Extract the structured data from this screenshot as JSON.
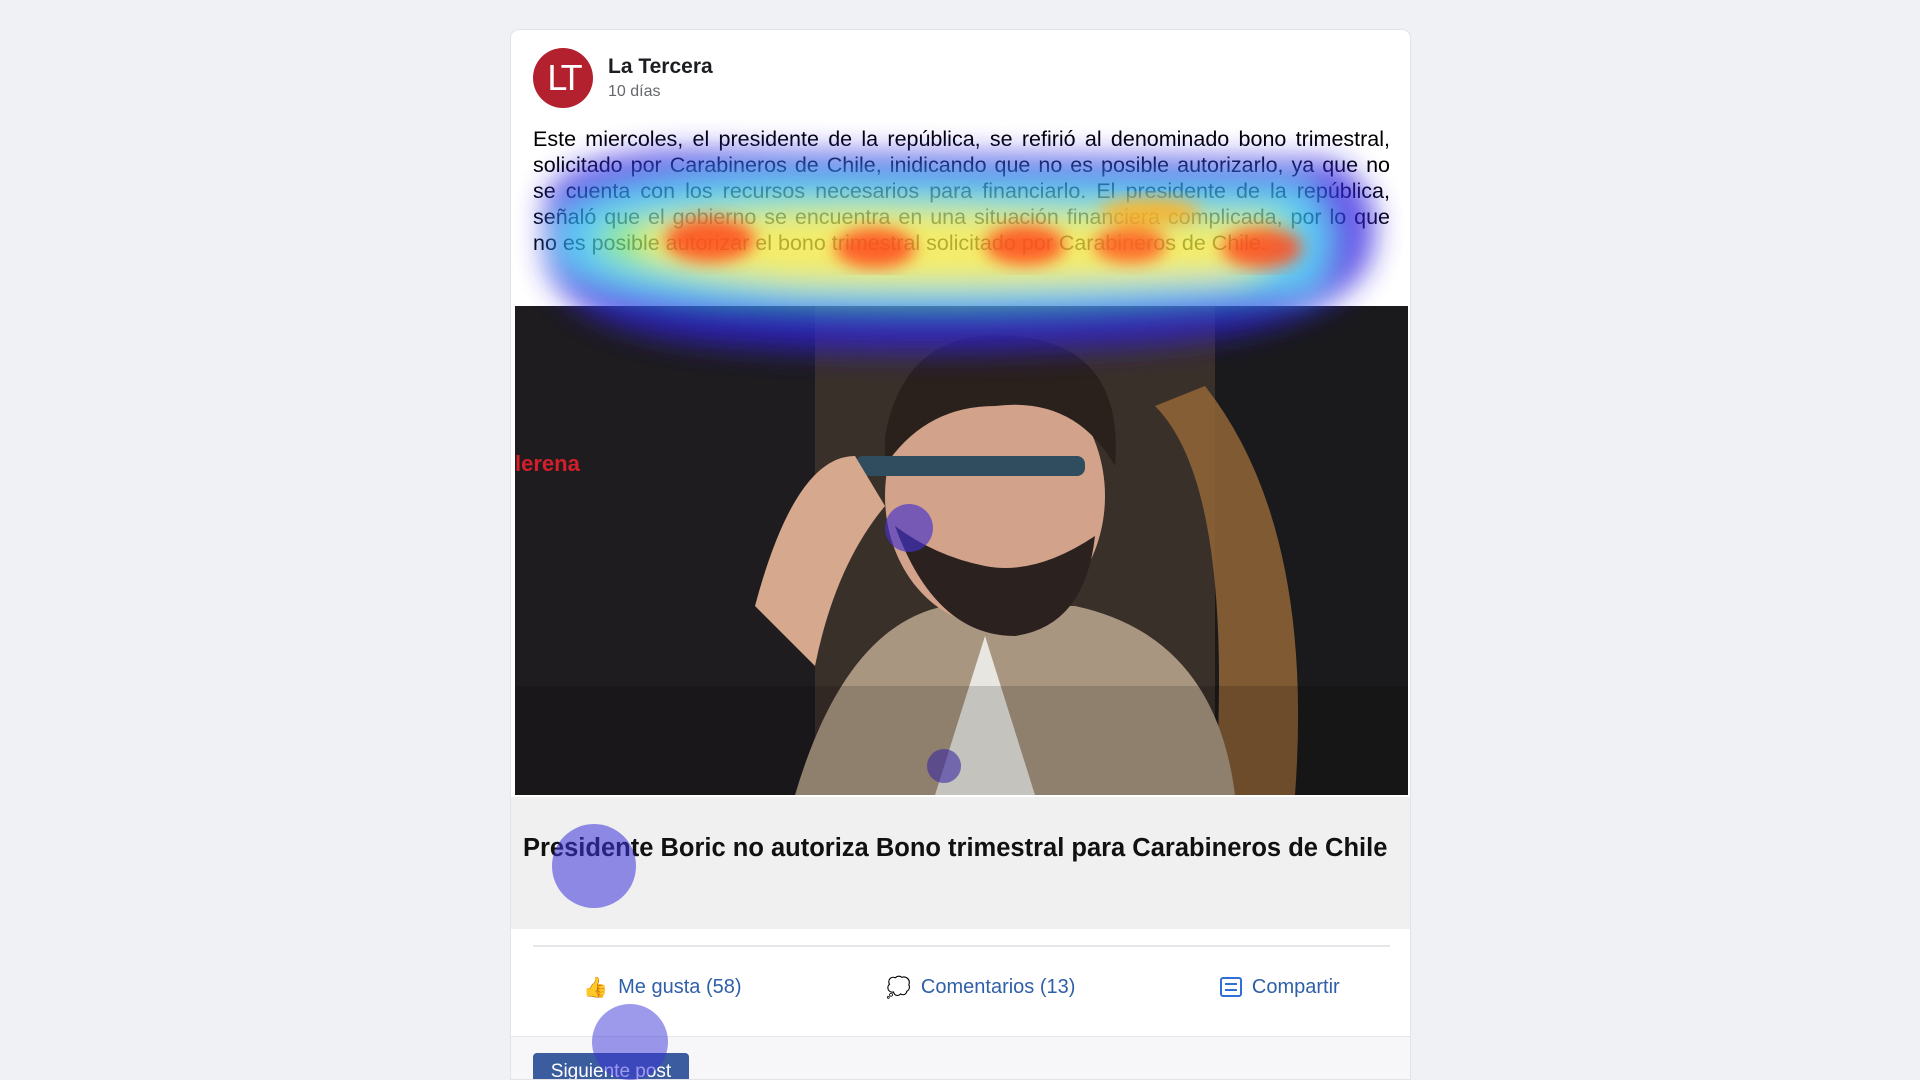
{
  "post": {
    "source": "La Tercera",
    "logo_text": "LT",
    "time": "10 días",
    "body": "Este miercoles, el presidente de la república, se refirió al denominado bono trimestral, solicitado por Carabineros de Chile, inidicando que no es posible autorizarlo, ya que no se cuenta con los recursos necesarios para financiarlo. El presidente de la república, señaló que el gobierno se encuentra en una situación financiera complicada, por lo que no es posible autorizar el bono trimestral solicitado por Carabineros de Chile.",
    "image_caption_fragment": "lerena",
    "title": "Presidente Boric no autoriza Bono trimestral para Carabineros de Chile"
  },
  "actions": {
    "like": {
      "label": "Me gusta (58)",
      "icon": "thumbs-up-icon"
    },
    "comment": {
      "label": "Comentarios (13)",
      "icon": "speech-bubble-icon"
    },
    "share": {
      "label": "Compartir",
      "icon": "share-icon"
    }
  },
  "footer": {
    "next_label": "Siguiente post"
  },
  "colors": {
    "logo": "#b3202e",
    "link": "#2f5fa8",
    "button": "#3b5c9e",
    "background": "#f0f1f5"
  }
}
